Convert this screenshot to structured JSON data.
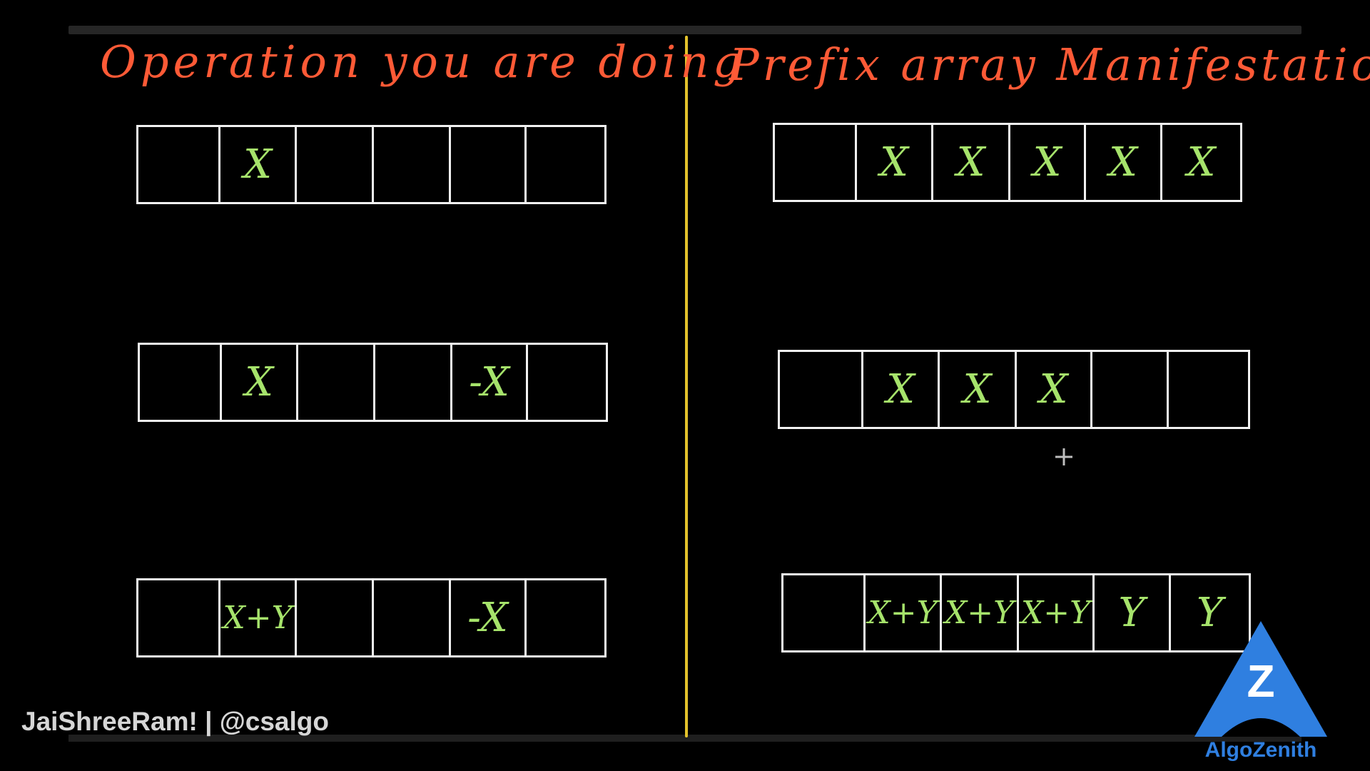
{
  "headings": {
    "left": "Operation you are doing",
    "right": "Prefix array Manifestation"
  },
  "left_arrays": [
    {
      "cells": [
        "",
        "X",
        "",
        "",
        "",
        ""
      ]
    },
    {
      "cells": [
        "",
        "X",
        "",
        "",
        "-X",
        ""
      ]
    },
    {
      "cells": [
        "",
        "X+Y",
        "",
        "",
        "-X",
        ""
      ]
    }
  ],
  "right_arrays": [
    {
      "cells": [
        "",
        "X",
        "X",
        "X",
        "X",
        "X"
      ]
    },
    {
      "cells": [
        "",
        "X",
        "X",
        "X",
        "",
        ""
      ]
    },
    {
      "cells": [
        "",
        "X+Y",
        "X+Y",
        "X+Y",
        "Y",
        "Y"
      ]
    }
  ],
  "watermark": "JaiShreeRam! | @csalgo",
  "logo": {
    "letter": "Z",
    "name": "AlgoZenith",
    "icon": "algozenith-logo-icon",
    "color": "#2f7fe0"
  },
  "colors": {
    "heading": "#ff5a36",
    "cell_text": "#a6e36b",
    "divider": "#e3c22b",
    "cell_border": "#f2f2f2"
  }
}
